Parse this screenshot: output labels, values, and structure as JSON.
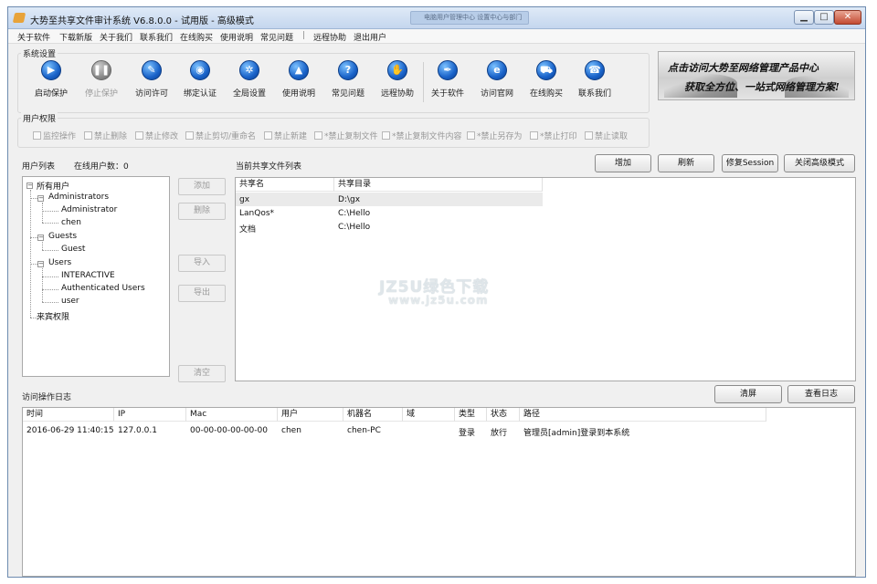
{
  "window": {
    "title": "大势至共享文件审计系统 V6.8.0.0 - 试用版 - 高级模式",
    "ghost_tab": "电脑用户管理中心 设置中心与部门",
    "controls": {
      "minimize": "▁",
      "maximize": "□",
      "close": "✕"
    }
  },
  "menu": {
    "items": [
      "关于软件",
      "下载新版",
      "关于我们",
      "联系我们",
      "在线购买",
      "使用说明",
      "常见问题"
    ],
    "separator": "|",
    "items_right": [
      "远程协助",
      "退出用户"
    ]
  },
  "system": {
    "label": "系统设置",
    "buttons": [
      {
        "label": "启动保护",
        "icon": "play-icon",
        "glyph": "▶",
        "enabled": true
      },
      {
        "label": "停止保护",
        "icon": "pause-icon",
        "glyph": "❚❚",
        "enabled": false
      },
      {
        "label": "访问许可",
        "icon": "key-icon",
        "glyph": "✎",
        "enabled": true
      },
      {
        "label": "绑定认证",
        "icon": "globe-icon",
        "glyph": "◉",
        "enabled": true
      },
      {
        "label": "全局设置",
        "icon": "gear-icon",
        "glyph": "✲",
        "enabled": true
      },
      {
        "label": "使用说明",
        "icon": "graduation-cap-icon",
        "glyph": "▲",
        "enabled": true
      },
      {
        "label": "常见问题",
        "icon": "help-icon",
        "glyph": "?",
        "enabled": true
      },
      {
        "label": "远程协助",
        "icon": "handshake-icon",
        "glyph": "✋",
        "enabled": true
      },
      {
        "label": "关于软件",
        "icon": "pen-icon",
        "glyph": "✒",
        "enabled": true
      },
      {
        "label": "访问官网",
        "icon": "browser-icon",
        "glyph": "e",
        "enabled": true
      },
      {
        "label": "在线购买",
        "icon": "cart-icon",
        "glyph": "⛟",
        "enabled": true
      },
      {
        "label": "联系我们",
        "icon": "phone-icon",
        "glyph": "☎",
        "enabled": true
      }
    ]
  },
  "banner": {
    "line1": "点击访问大势至网络管理产品中心",
    "line2": "获取全方位、一站式网络管理方案!"
  },
  "permissions": {
    "label": "用户权限",
    "items": [
      "监控操作",
      "禁止删除",
      "禁止修改",
      "禁止剪切/重命名",
      "禁止新建",
      "*禁止复制文件",
      "*禁止复制文件内容",
      "*禁止另存为",
      "*禁止打印",
      "禁止读取"
    ]
  },
  "users": {
    "label": "用户列表",
    "online_label": "在线用户数：",
    "online_count": "0",
    "tree": [
      {
        "text": "所有用户",
        "level": 0
      },
      {
        "text": "Administrators",
        "level": 1
      },
      {
        "text": "Administrator",
        "level": 2
      },
      {
        "text": "chen",
        "level": 2
      },
      {
        "text": "Guests",
        "level": 1
      },
      {
        "text": "Guest",
        "level": 2
      },
      {
        "text": "Users",
        "level": 1
      },
      {
        "text": "INTERACTIVE",
        "level": 2
      },
      {
        "text": "Authenticated Users",
        "level": 2
      },
      {
        "text": "user",
        "level": 2
      },
      {
        "text": "来宾权限",
        "level": 0
      }
    ]
  },
  "middle_buttons": {
    "add": "添加",
    "delete": "删除",
    "import": "导入",
    "export": "导出",
    "clear": "清空"
  },
  "shares": {
    "label": "当前共享文件列表",
    "buttons": {
      "add": "增加",
      "refresh": "刷新",
      "repair": "修复Session",
      "close_advanced": "关闭高级模式"
    },
    "columns": [
      "共享名",
      "共享目录"
    ],
    "rows": [
      [
        "gx",
        "D:\\gx"
      ],
      [
        "LanQos*",
        "C:\\Hello"
      ],
      [
        "文档",
        "C:\\Hello"
      ]
    ]
  },
  "log": {
    "label": "访问操作日志",
    "buttons": {
      "clear": "清屏",
      "view": "查看日志"
    },
    "columns": [
      "时间",
      "IP",
      "Mac",
      "用户",
      "机器名",
      "域",
      "类型",
      "状态",
      "路径"
    ],
    "rows": [
      [
        "2016-06-29 11:40:15",
        "127.0.0.1",
        "00-00-00-00-00-00",
        "chen",
        "chen-PC",
        "",
        "登录",
        "放行",
        "管理员[admin]登录到本系统"
      ]
    ]
  },
  "watermark": {
    "line1": "JZ5U绿色下载",
    "line2": "www.jz5u.com"
  }
}
